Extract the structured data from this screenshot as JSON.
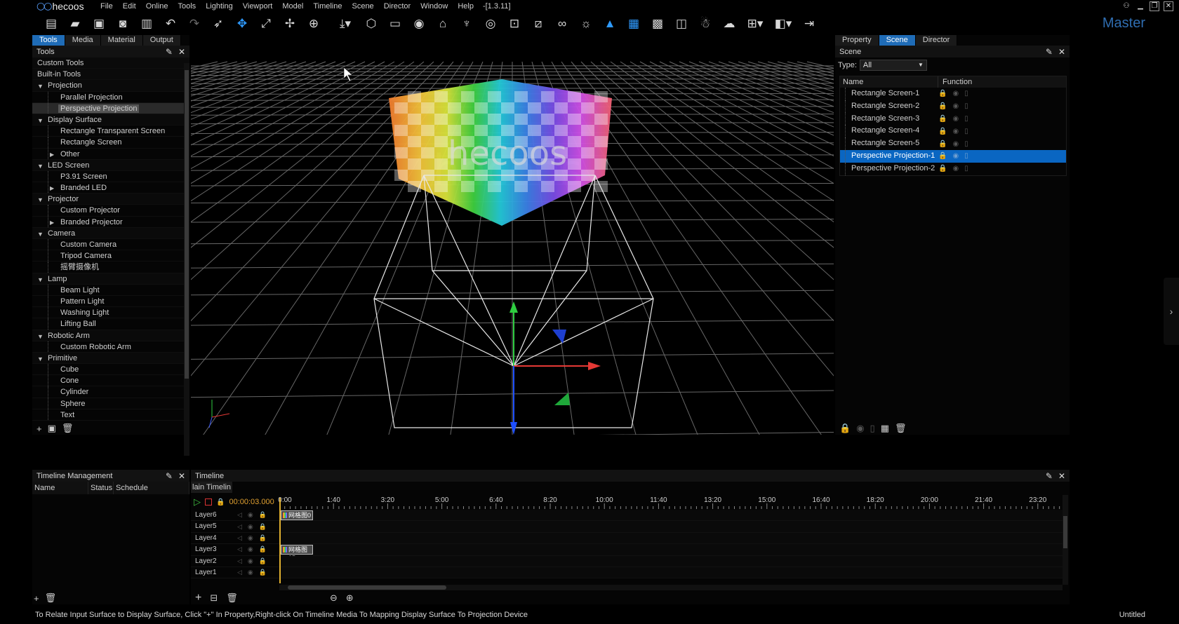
{
  "app": {
    "logo_text": "hecoos",
    "version": "-[1.3.11]",
    "mode_label": "Master",
    "menu": [
      "File",
      "Edit",
      "Online",
      "Tools",
      "Lighting",
      "Viewport",
      "Model",
      "Timeline",
      "Scene",
      "Director",
      "Window",
      "Help"
    ]
  },
  "toolbar": {
    "icons": [
      "new-file-icon",
      "open-folder-icon",
      "save-icon",
      "save-as-icon",
      "clipboard-icon",
      "undo-icon",
      "redo-icon",
      "select-icon",
      "move-icon",
      "scale-icon",
      "rotate-icon",
      "globe-icon",
      "import-icon",
      "box-icon",
      "panel-icon",
      "eye-icon",
      "projector-icon",
      "lamp-icon",
      "camera-icon",
      "focus-icon",
      "ruler-icon",
      "link-icon",
      "sun-icon",
      "rocket-icon",
      "grid-icon",
      "fps-icon",
      "layers-icon",
      "people-icon",
      "weather-icon",
      "layout-icon",
      "split-icon",
      "exit-icon"
    ]
  },
  "tools_panel": {
    "tabs": [
      {
        "label": "Tools",
        "active": true
      },
      {
        "label": "Media",
        "active": false
      },
      {
        "label": "Material",
        "active": false
      },
      {
        "label": "Output",
        "active": false
      }
    ],
    "title": "Tools",
    "top_items": [
      "Custom Tools",
      "Built-in Tools"
    ],
    "categories": [
      {
        "label": "Projection",
        "items": [
          {
            "label": "Parallel Projection"
          },
          {
            "label": "Perspective Projection",
            "selected": true
          }
        ]
      },
      {
        "label": "Display Surface",
        "items": [
          {
            "label": "Rectangle Transparent Screen"
          },
          {
            "label": "Rectangle Screen"
          },
          {
            "label": "Other",
            "collapsed": true
          }
        ]
      },
      {
        "label": "LED Screen",
        "items": [
          {
            "label": "P3.91 Screen"
          },
          {
            "label": "Branded LED",
            "collapsed": true
          }
        ]
      },
      {
        "label": "Projector",
        "items": [
          {
            "label": "Custom Projector"
          },
          {
            "label": "Branded Projector",
            "collapsed": true
          }
        ]
      },
      {
        "label": "Camera",
        "items": [
          {
            "label": "Custom Camera"
          },
          {
            "label": "Tripod Camera"
          },
          {
            "label": "摇臂摄像机"
          }
        ]
      },
      {
        "label": "Lamp",
        "items": [
          {
            "label": "Beam Light"
          },
          {
            "label": "Pattern Light"
          },
          {
            "label": "Washing Light"
          },
          {
            "label": "Lifting Ball"
          }
        ]
      },
      {
        "label": "Robotic Arm",
        "items": [
          {
            "label": "Custom Robotic Arm"
          }
        ]
      },
      {
        "label": "Primitive",
        "items": [
          {
            "label": "Cube"
          },
          {
            "label": "Cone"
          },
          {
            "label": "Cylinder"
          },
          {
            "label": "Sphere"
          },
          {
            "label": "Text"
          }
        ]
      }
    ]
  },
  "viewport": {
    "screen_watermark": "hecoos"
  },
  "scene_panel": {
    "tabs": [
      {
        "label": "Property",
        "active": false
      },
      {
        "label": "Scene",
        "active": true
      },
      {
        "label": "Director",
        "active": false
      }
    ],
    "title": "Scene",
    "type_label": "Type:",
    "type_value": "All",
    "col_name": "Name",
    "col_function": "Function",
    "rows": [
      {
        "name": "Rectangle Screen-1"
      },
      {
        "name": "Rectangle Screen-2"
      },
      {
        "name": "Rectangle Screen-3"
      },
      {
        "name": "Rectangle Screen-4"
      },
      {
        "name": "Rectangle Screen-5"
      },
      {
        "name": "Perspective Projection-1",
        "selected": true
      },
      {
        "name": "Perspective Projection-2"
      }
    ]
  },
  "timeline_management": {
    "title": "Timeline Management",
    "col_name": "Name",
    "col_status": "Status",
    "col_schedule": "Schedule"
  },
  "timeline": {
    "title": "Timeline",
    "subtab": "lain Timelin",
    "current_time": "00:00:03.000",
    "ticks": [
      "0:00",
      "1:40",
      "3:20",
      "5:00",
      "6:40",
      "8:20",
      "10:00",
      "11:40",
      "13:20",
      "15:00",
      "16:40",
      "18:20",
      "20:00",
      "21:40",
      "23:20"
    ],
    "layers": [
      {
        "name": "Layer6",
        "clip": "网格图0"
      },
      {
        "name": "Layer5",
        "clip": ""
      },
      {
        "name": "Layer4",
        "clip": ""
      },
      {
        "name": "Layer3",
        "clip": "网格图05"
      },
      {
        "name": "Layer2",
        "clip": ""
      },
      {
        "name": "Layer1",
        "clip": ""
      }
    ]
  },
  "status": {
    "text": "To Relate Input Surface to Display Surface, Click \"+\" In Property,Right-click On Timeline Media To Mapping Display Surface To Projection Device",
    "document": "Untitled"
  },
  "colors": {
    "accent": "#1f6cb7",
    "selection": "#0a66c2",
    "timecode": "#e0a030"
  }
}
